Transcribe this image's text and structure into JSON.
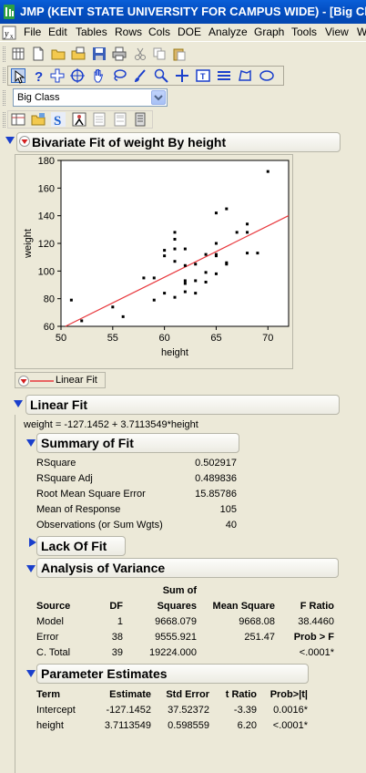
{
  "window": {
    "title": "JMP (KENT STATE UNIVERSITY FOR CAMPUS WIDE)  - [Big Class"
  },
  "menubar": {
    "items": [
      "File",
      "Edit",
      "Tables",
      "Rows",
      "Cols",
      "DOE",
      "Analyze",
      "Graph",
      "Tools",
      "View",
      "W"
    ]
  },
  "table_selector": {
    "value": "Big Class"
  },
  "report": {
    "bivariate_title": "Bivariate Fit of weight By height",
    "legend_label": "Linear Fit",
    "linear_fit_title": "Linear Fit",
    "equation": "weight = -127.1452 + 3.7113549*height",
    "summary": {
      "title": "Summary of Fit",
      "rows": [
        {
          "label": "RSquare",
          "value": "0.502917"
        },
        {
          "label": "RSquare Adj",
          "value": "0.489836"
        },
        {
          "label": "Root Mean Square Error",
          "value": "15.85786"
        },
        {
          "label": "Mean of Response",
          "value": "105"
        },
        {
          "label": "Observations (or Sum Wgts)",
          "value": "40"
        }
      ]
    },
    "lack_of_fit_title": "Lack Of Fit",
    "anova": {
      "title": "Analysis of Variance",
      "headers": {
        "sum_of": "Sum of",
        "source": "Source",
        "df": "DF",
        "squares": "Squares",
        "mean_square": "Mean Square",
        "f_ratio": "F Ratio"
      },
      "rows": [
        {
          "source": "Model",
          "df": "1",
          "ss": "9668.079",
          "ms": "9668.08",
          "f": "38.4460"
        },
        {
          "source": "Error",
          "df": "38",
          "ss": "9555.921",
          "ms": "251.47",
          "f": "Prob > F"
        },
        {
          "source": "C. Total",
          "df": "39",
          "ss": "19224.000",
          "ms": "",
          "f": "<.0001*"
        }
      ]
    },
    "params": {
      "title": "Parameter Estimates",
      "headers": {
        "term": "Term",
        "estimate": "Estimate",
        "std_error": "Std Error",
        "t_ratio": "t Ratio",
        "prob": "Prob>|t|"
      },
      "rows": [
        {
          "term": "Intercept",
          "estimate": "-127.1452",
          "std_error": "37.52372",
          "t_ratio": "-3.39",
          "prob": "0.0016*"
        },
        {
          "term": "height",
          "estimate": "3.7113549",
          "std_error": "0.598559",
          "t_ratio": "6.20",
          "prob": "<.0001*"
        }
      ]
    }
  },
  "colors": {
    "titlebar": "#0450c4",
    "fit_line": "#e8383d",
    "triangle_blue": "#1a3fcc",
    "triangle_red": "#d42020"
  },
  "chart_data": {
    "type": "scatter",
    "title": "",
    "xlabel": "height",
    "ylabel": "weight",
    "xlim": [
      50,
      72
    ],
    "ylim": [
      60,
      180
    ],
    "xticks": [
      50,
      55,
      60,
      65,
      70
    ],
    "yticks": [
      60,
      80,
      100,
      120,
      140,
      160,
      180
    ],
    "points": [
      [
        51,
        79
      ],
      [
        52,
        64
      ],
      [
        55,
        74
      ],
      [
        56,
        67
      ],
      [
        58,
        95
      ],
      [
        59,
        95
      ],
      [
        59,
        79
      ],
      [
        60,
        111
      ],
      [
        60,
        115
      ],
      [
        60,
        84
      ],
      [
        61,
        128
      ],
      [
        61,
        123
      ],
      [
        61,
        107
      ],
      [
        61,
        116
      ],
      [
        61,
        81
      ],
      [
        62,
        85
      ],
      [
        62,
        91
      ],
      [
        62,
        93
      ],
      [
        62,
        104
      ],
      [
        62,
        116
      ],
      [
        63,
        84
      ],
      [
        63,
        93
      ],
      [
        63,
        105
      ],
      [
        64,
        92
      ],
      [
        64,
        99
      ],
      [
        64,
        112
      ],
      [
        65,
        142
      ],
      [
        65,
        120
      ],
      [
        65,
        111
      ],
      [
        65,
        98
      ],
      [
        65,
        112
      ],
      [
        66,
        145
      ],
      [
        66,
        105
      ],
      [
        66,
        106
      ],
      [
        67,
        128
      ],
      [
        68,
        134
      ],
      [
        68,
        128
      ],
      [
        68,
        113
      ],
      [
        69,
        113
      ],
      [
        70,
        172
      ]
    ],
    "fit_line": {
      "intercept": -127.1452,
      "slope": 3.7113549
    }
  }
}
